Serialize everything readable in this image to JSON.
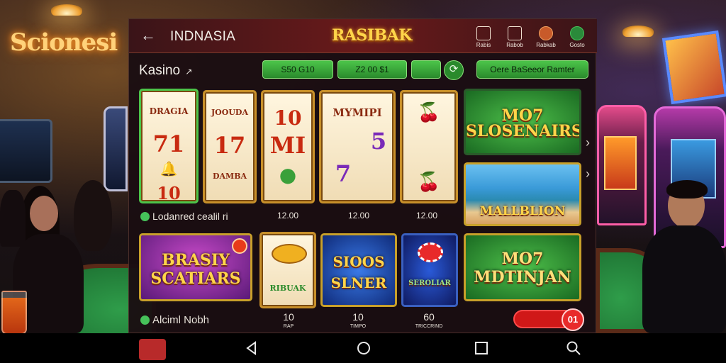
{
  "background": {
    "neon_sign": "Scionesi"
  },
  "header": {
    "region": "INDNASIA",
    "logo": "RASIBAK",
    "icons": [
      {
        "name": "trophy-icon",
        "label": "Rabis"
      },
      {
        "name": "wallet-icon",
        "label": "Rabob"
      },
      {
        "name": "chat-icon",
        "label": "Rabkab"
      },
      {
        "name": "profile-icon",
        "label": "Gosto"
      }
    ]
  },
  "subbar": {
    "title": "Kasino",
    "arrow": "↗",
    "pills": [
      "S50 G10",
      "Z2 00 $1",
      ""
    ],
    "promo": "Oere BaSeeor Ramter"
  },
  "games_row1": [
    {
      "name": "reel-1",
      "symbols": [
        "DRAGIA",
        "71",
        "🔔",
        "10"
      ],
      "caption": ""
    },
    {
      "name": "reel-2",
      "symbols": [
        "JOOUDA",
        "17",
        "DAMBA",
        ""
      ],
      "caption": ""
    },
    {
      "name": "reel-3",
      "symbols": [
        "",
        "10",
        "MI",
        "●"
      ],
      "caption": "12.00"
    },
    {
      "name": "reel-4",
      "symbols": [
        "MYMIPI",
        "5",
        "7",
        ""
      ],
      "caption": "12.00"
    },
    {
      "name": "reel-5",
      "symbols": [
        "🍒",
        "",
        "",
        "🍒"
      ],
      "caption": "12.00"
    }
  ],
  "featured": [
    {
      "title": "MO7 SLOSENAIRS",
      "theme": "green"
    },
    {
      "title": "MALLBLION",
      "theme": "beach"
    }
  ],
  "row1_label": "Lodanred cealil",
  "row1_label_suffix": "ri",
  "games_row2": [
    {
      "name": "brasiy-scathars",
      "title": "BRASIY SCATIARS"
    },
    {
      "name": "reel-6",
      "title": "RIBUAK"
    },
    {
      "name": "slner",
      "title": "SIOOS SLNER"
    },
    {
      "name": "reel-7",
      "title": "SEROLIAR"
    },
    {
      "name": "mo7-mdtinjan",
      "title": "MO7 MDTINJAN"
    }
  ],
  "row2_label": "Alciml Nobh",
  "row2_stats": [
    {
      "value": "10",
      "sub": "RAP"
    },
    {
      "value": "10",
      "sub": "TIMPO"
    },
    {
      "value": "60",
      "sub": "TRICCRIND"
    }
  ],
  "toggle": {
    "badge": "01"
  },
  "colors": {
    "accent_green": "#4cc54a",
    "brand_red": "#6a1a1a",
    "gold": "#ffd54a"
  }
}
